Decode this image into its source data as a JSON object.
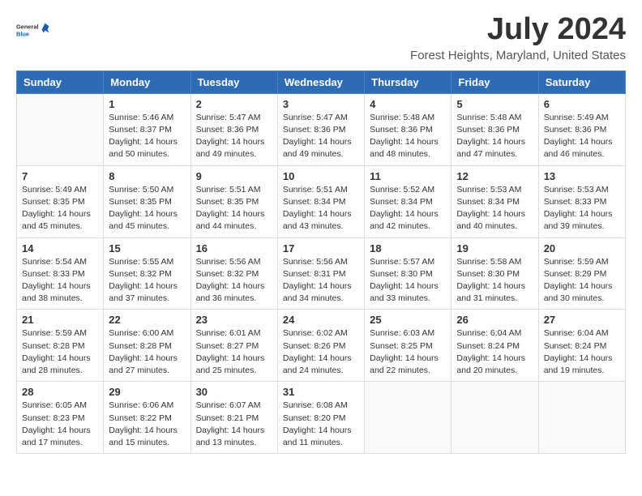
{
  "logo": {
    "text_general": "General",
    "text_blue": "Blue"
  },
  "title": "July 2024",
  "subtitle": "Forest Heights, Maryland, United States",
  "days_of_week": [
    "Sunday",
    "Monday",
    "Tuesday",
    "Wednesday",
    "Thursday",
    "Friday",
    "Saturday"
  ],
  "weeks": [
    [
      {
        "day": "",
        "info": ""
      },
      {
        "day": "1",
        "info": "Sunrise: 5:46 AM\nSunset: 8:37 PM\nDaylight: 14 hours\nand 50 minutes."
      },
      {
        "day": "2",
        "info": "Sunrise: 5:47 AM\nSunset: 8:36 PM\nDaylight: 14 hours\nand 49 minutes."
      },
      {
        "day": "3",
        "info": "Sunrise: 5:47 AM\nSunset: 8:36 PM\nDaylight: 14 hours\nand 49 minutes."
      },
      {
        "day": "4",
        "info": "Sunrise: 5:48 AM\nSunset: 8:36 PM\nDaylight: 14 hours\nand 48 minutes."
      },
      {
        "day": "5",
        "info": "Sunrise: 5:48 AM\nSunset: 8:36 PM\nDaylight: 14 hours\nand 47 minutes."
      },
      {
        "day": "6",
        "info": "Sunrise: 5:49 AM\nSunset: 8:36 PM\nDaylight: 14 hours\nand 46 minutes."
      }
    ],
    [
      {
        "day": "7",
        "info": "Sunrise: 5:49 AM\nSunset: 8:35 PM\nDaylight: 14 hours\nand 45 minutes."
      },
      {
        "day": "8",
        "info": "Sunrise: 5:50 AM\nSunset: 8:35 PM\nDaylight: 14 hours\nand 45 minutes."
      },
      {
        "day": "9",
        "info": "Sunrise: 5:51 AM\nSunset: 8:35 PM\nDaylight: 14 hours\nand 44 minutes."
      },
      {
        "day": "10",
        "info": "Sunrise: 5:51 AM\nSunset: 8:34 PM\nDaylight: 14 hours\nand 43 minutes."
      },
      {
        "day": "11",
        "info": "Sunrise: 5:52 AM\nSunset: 8:34 PM\nDaylight: 14 hours\nand 42 minutes."
      },
      {
        "day": "12",
        "info": "Sunrise: 5:53 AM\nSunset: 8:34 PM\nDaylight: 14 hours\nand 40 minutes."
      },
      {
        "day": "13",
        "info": "Sunrise: 5:53 AM\nSunset: 8:33 PM\nDaylight: 14 hours\nand 39 minutes."
      }
    ],
    [
      {
        "day": "14",
        "info": "Sunrise: 5:54 AM\nSunset: 8:33 PM\nDaylight: 14 hours\nand 38 minutes."
      },
      {
        "day": "15",
        "info": "Sunrise: 5:55 AM\nSunset: 8:32 PM\nDaylight: 14 hours\nand 37 minutes."
      },
      {
        "day": "16",
        "info": "Sunrise: 5:56 AM\nSunset: 8:32 PM\nDaylight: 14 hours\nand 36 minutes."
      },
      {
        "day": "17",
        "info": "Sunrise: 5:56 AM\nSunset: 8:31 PM\nDaylight: 14 hours\nand 34 minutes."
      },
      {
        "day": "18",
        "info": "Sunrise: 5:57 AM\nSunset: 8:30 PM\nDaylight: 14 hours\nand 33 minutes."
      },
      {
        "day": "19",
        "info": "Sunrise: 5:58 AM\nSunset: 8:30 PM\nDaylight: 14 hours\nand 31 minutes."
      },
      {
        "day": "20",
        "info": "Sunrise: 5:59 AM\nSunset: 8:29 PM\nDaylight: 14 hours\nand 30 minutes."
      }
    ],
    [
      {
        "day": "21",
        "info": "Sunrise: 5:59 AM\nSunset: 8:28 PM\nDaylight: 14 hours\nand 28 minutes."
      },
      {
        "day": "22",
        "info": "Sunrise: 6:00 AM\nSunset: 8:28 PM\nDaylight: 14 hours\nand 27 minutes."
      },
      {
        "day": "23",
        "info": "Sunrise: 6:01 AM\nSunset: 8:27 PM\nDaylight: 14 hours\nand 25 minutes."
      },
      {
        "day": "24",
        "info": "Sunrise: 6:02 AM\nSunset: 8:26 PM\nDaylight: 14 hours\nand 24 minutes."
      },
      {
        "day": "25",
        "info": "Sunrise: 6:03 AM\nSunset: 8:25 PM\nDaylight: 14 hours\nand 22 minutes."
      },
      {
        "day": "26",
        "info": "Sunrise: 6:04 AM\nSunset: 8:24 PM\nDaylight: 14 hours\nand 20 minutes."
      },
      {
        "day": "27",
        "info": "Sunrise: 6:04 AM\nSunset: 8:24 PM\nDaylight: 14 hours\nand 19 minutes."
      }
    ],
    [
      {
        "day": "28",
        "info": "Sunrise: 6:05 AM\nSunset: 8:23 PM\nDaylight: 14 hours\nand 17 minutes."
      },
      {
        "day": "29",
        "info": "Sunrise: 6:06 AM\nSunset: 8:22 PM\nDaylight: 14 hours\nand 15 minutes."
      },
      {
        "day": "30",
        "info": "Sunrise: 6:07 AM\nSunset: 8:21 PM\nDaylight: 14 hours\nand 13 minutes."
      },
      {
        "day": "31",
        "info": "Sunrise: 6:08 AM\nSunset: 8:20 PM\nDaylight: 14 hours\nand 11 minutes."
      },
      {
        "day": "",
        "info": ""
      },
      {
        "day": "",
        "info": ""
      },
      {
        "day": "",
        "info": ""
      }
    ]
  ]
}
